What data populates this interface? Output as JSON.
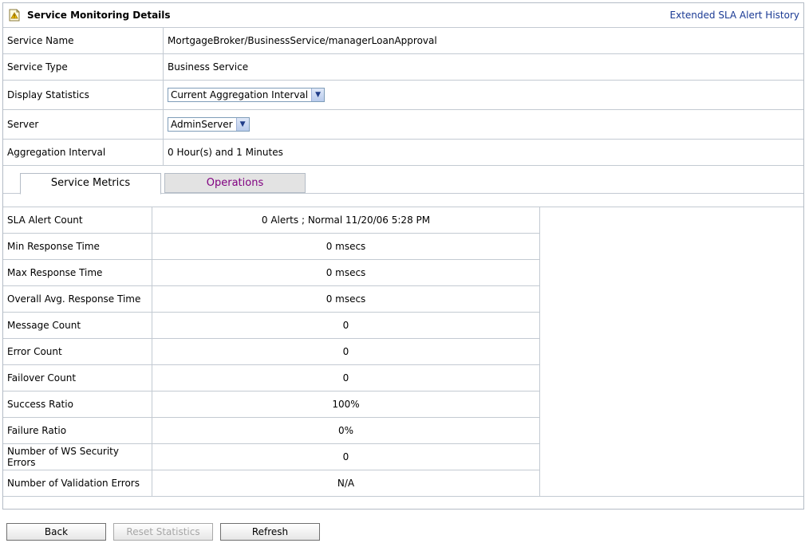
{
  "header": {
    "title": "Service Monitoring Details",
    "link": "Extended SLA Alert History"
  },
  "details": {
    "service_name": {
      "label": "Service Name",
      "value": "MortgageBroker/BusinessService/managerLoanApproval"
    },
    "service_type": {
      "label": "Service Type",
      "value": "Business Service"
    },
    "display_statistics": {
      "label": "Display Statistics",
      "selected": "Current Aggregation Interval"
    },
    "server": {
      "label": "Server",
      "selected": "AdminServer"
    },
    "aggregation_interval": {
      "label": "Aggregation Interval",
      "value": "0 Hour(s) and 1 Minutes"
    }
  },
  "tabs": [
    {
      "label": "Service Metrics",
      "active": true
    },
    {
      "label": "Operations",
      "active": false
    }
  ],
  "metrics": [
    {
      "label": "SLA Alert Count",
      "value": "0 Alerts ; Normal 11/20/06 5:28 PM"
    },
    {
      "label": "Min Response Time",
      "value": "0 msecs"
    },
    {
      "label": "Max Response Time",
      "value": "0 msecs"
    },
    {
      "label": "Overall Avg. Response Time",
      "value": "0 msecs"
    },
    {
      "label": "Message Count",
      "value": "0"
    },
    {
      "label": "Error Count",
      "value": "0"
    },
    {
      "label": "Failover Count",
      "value": "0"
    },
    {
      "label": "Success Ratio",
      "value": "100%"
    },
    {
      "label": "Failure Ratio",
      "value": "0%"
    },
    {
      "label": "Number of WS Security Errors",
      "value": "0"
    },
    {
      "label": "Number of Validation Errors",
      "value": "N/A"
    }
  ],
  "buttons": {
    "back": "Back",
    "reset_statistics": "Reset Statistics",
    "refresh": "Refresh"
  },
  "colors": {
    "link": "#1a3a94",
    "inactive_tab_text": "#800080",
    "border": "#c3cad2"
  }
}
